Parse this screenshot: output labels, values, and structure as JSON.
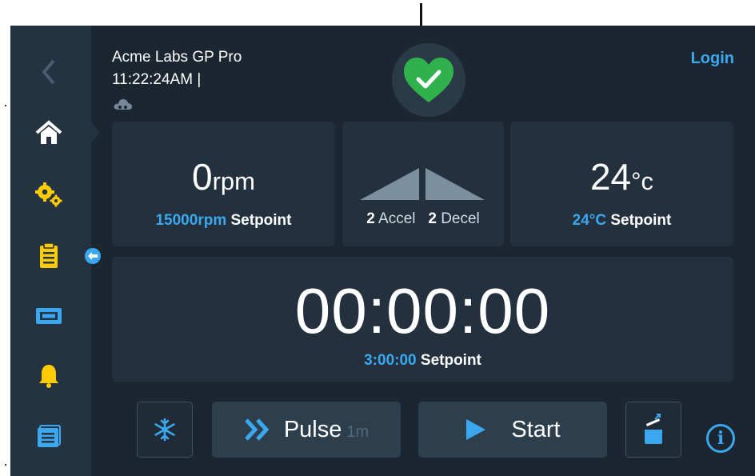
{
  "header": {
    "device_name": "Acme Labs GP Pro",
    "time": "11:22:24AM |",
    "login_label": "Login"
  },
  "sidebar": {
    "items": [
      {
        "icon": "chevron-left-icon"
      },
      {
        "icon": "home-icon"
      },
      {
        "icon": "gears-icon"
      },
      {
        "icon": "clipboard-icon"
      },
      {
        "icon": "rotor-icon"
      },
      {
        "icon": "bell-icon"
      },
      {
        "icon": "program-list-icon"
      }
    ]
  },
  "speed": {
    "value": "0",
    "unit": "rpm",
    "setpoint_value": "15000rpm",
    "setpoint_label": "Setpoint"
  },
  "ramp": {
    "accel_value": "2",
    "accel_label": "Accel",
    "decel_value": "2",
    "decel_label": "Decel"
  },
  "temperature": {
    "value": "24",
    "unit": "°c",
    "setpoint_value": "24°C",
    "setpoint_label": "Setpoint"
  },
  "timer": {
    "value": "00:00:00",
    "setpoint_value": "3:00:00",
    "setpoint_label": "Setpoint"
  },
  "buttons": {
    "pulse_label": "Pulse",
    "pulse_sub": "1m",
    "start_label": "Start",
    "info_symbol": "i"
  },
  "colors": {
    "accent": "#3aa7ef",
    "status_green": "#2fb14c",
    "background": "#1b2631",
    "sidebar": "#243341"
  }
}
